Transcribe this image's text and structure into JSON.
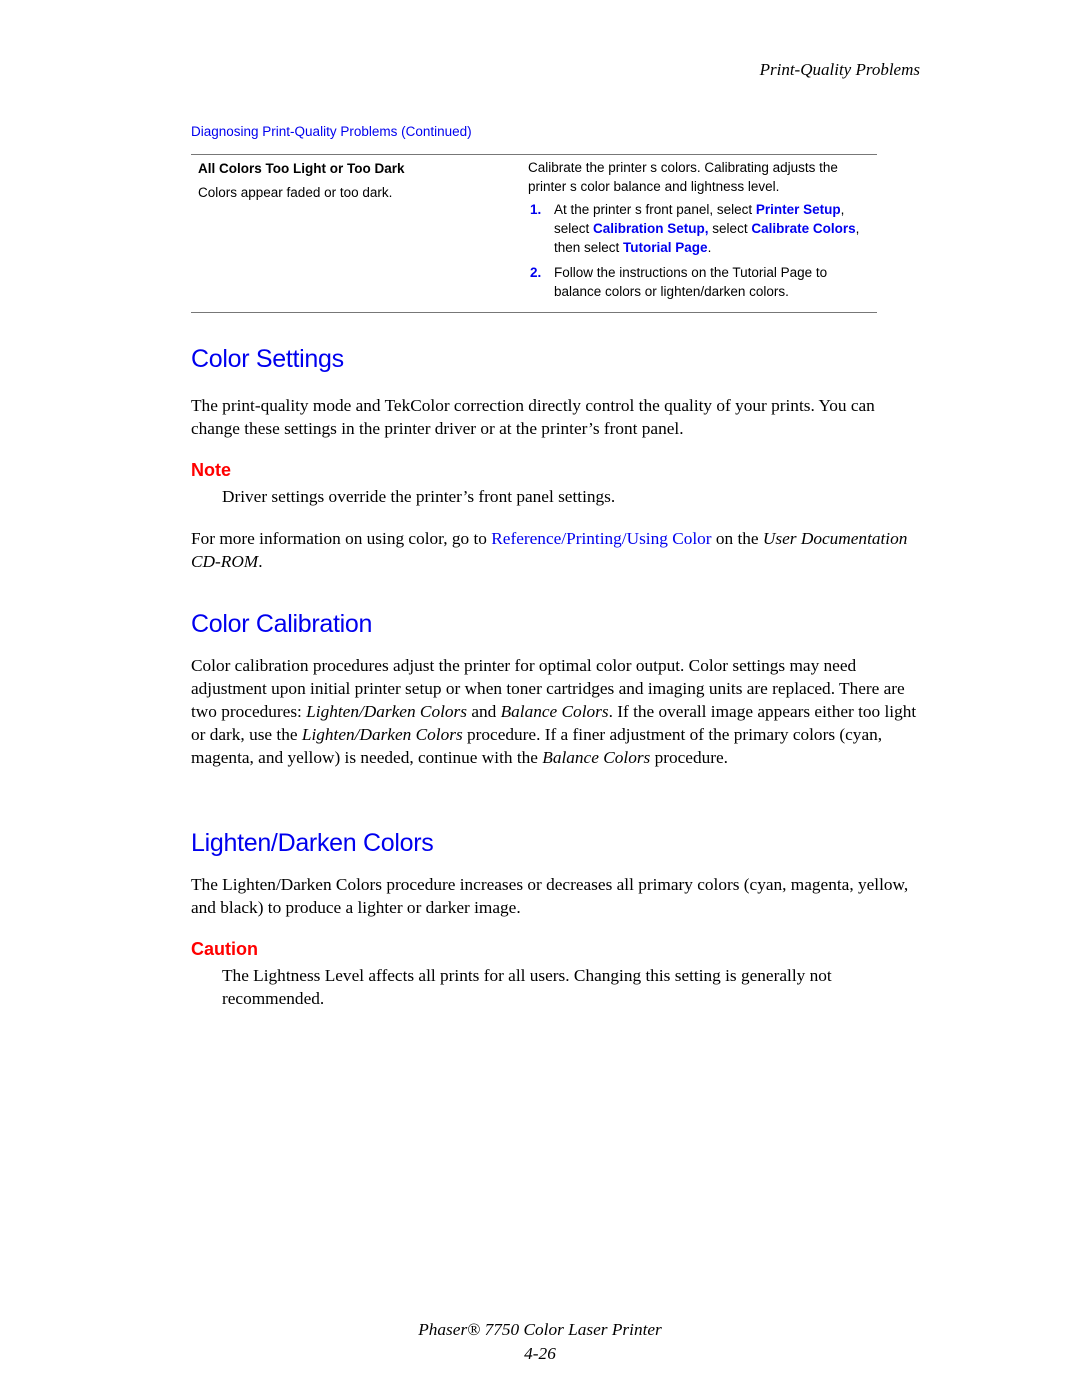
{
  "running_head": "Print-Quality Problems",
  "table": {
    "title": "Diagnosing Print-Quality Problems (Continued)",
    "row": {
      "problem_title": "All Colors Too Light or Too Dark",
      "problem_desc": "Colors appear faded or too dark.",
      "solution_intro": "Calibrate the printer s colors. Calibrating adjusts the printer s color balance and lightness level.",
      "steps": [
        {
          "num": "1.",
          "parts": [
            "At the printer s front panel, select ",
            "Printer Setup",
            ", select ",
            "Calibration Setup,",
            " select ",
            "Calibrate Colors",
            ", then select ",
            "Tutorial Page",
            "."
          ]
        },
        {
          "num": "2.",
          "text": "Follow the instructions on the Tutorial Page to balance colors or lighten/darken colors."
        }
      ]
    }
  },
  "sections": {
    "color_settings": {
      "heading": "Color Settings",
      "para": "The print-quality mode and TekColor correction directly control the quality of your prints. You can change these settings in the printer driver or at the printer’s front panel.",
      "note_label": "Note",
      "note_text": "Driver settings override the printer’s front panel settings.",
      "more_info": {
        "prefix": "For more information on using color, go to ",
        "link": "Reference/Printing/Using Color",
        "middle": " on the ",
        "doc_title": "User Documentation CD-ROM",
        "suffix": "."
      }
    },
    "color_calibration": {
      "heading": "Color Calibration",
      "parts": [
        "Color calibration procedures adjust the printer for optimal color output. Color settings may need adjustment upon initial printer setup or when toner cartridges and imaging units are replaced. There are two procedures: ",
        "Lighten/Darken Colors",
        " and ",
        "Balance Colors",
        ". If the overall image appears either too light or dark, use the ",
        "Lighten/Darken Colors",
        " procedure. If a finer adjustment of the primary colors (cyan, magenta, and yellow) is needed, continue with the ",
        "Balance Colors",
        " procedure."
      ]
    },
    "lighten_darken": {
      "heading": "Lighten/Darken Colors",
      "para": "The Lighten/Darken Colors procedure increases or decreases all primary colors (cyan, magenta, yellow, and black) to produce a lighter or darker image.",
      "caution_label": "Caution",
      "caution_text": "The Lightness Level affects all prints for all users. Changing this setting is generally not recommended."
    }
  },
  "footer": {
    "product": "Phaser® 7750 Color Laser Printer",
    "page": "4-26"
  },
  "colors": {
    "heading_blue": "#0000ee",
    "callout_red": "#ff0000"
  }
}
